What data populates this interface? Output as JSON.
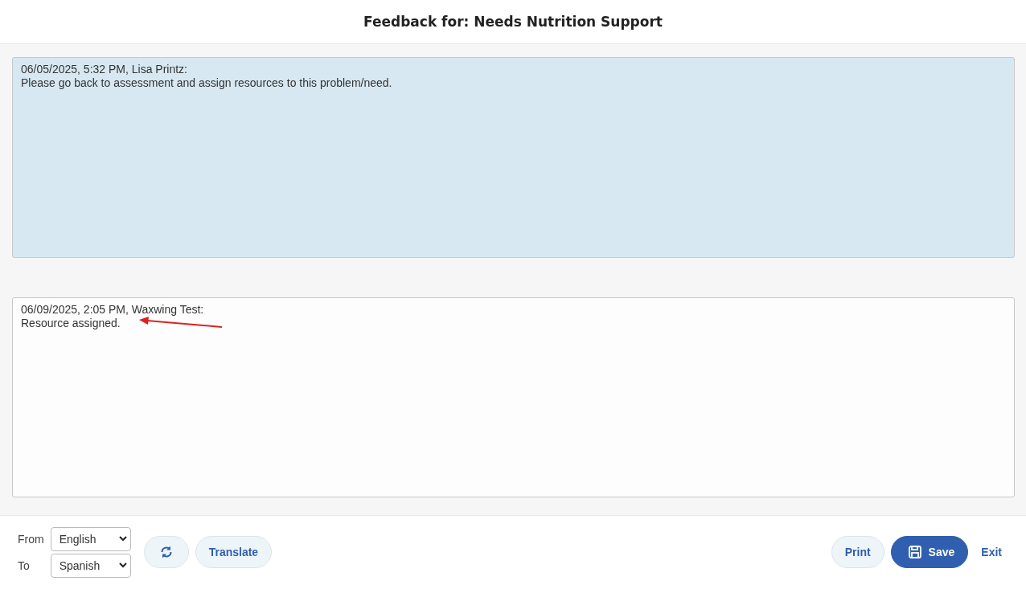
{
  "title": "Feedback for: Needs Nutrition Support",
  "entries": [
    {
      "kind": "history",
      "header": "06/05/2025, 5:32 PM, Lisa Printz:",
      "text": "Please go back to assessment and assign resources to this problem/need."
    },
    {
      "kind": "input",
      "header": "06/09/2025, 2:05 PM, Waxwing Test:",
      "text": "Resource assigned.",
      "annotated": true
    }
  ],
  "language": {
    "from_label": "From",
    "from": "English",
    "to_label": "To",
    "to": "Spanish"
  },
  "buttons": {
    "translate": "Translate",
    "print": "Print",
    "save": "Save",
    "exit": "Exit"
  }
}
